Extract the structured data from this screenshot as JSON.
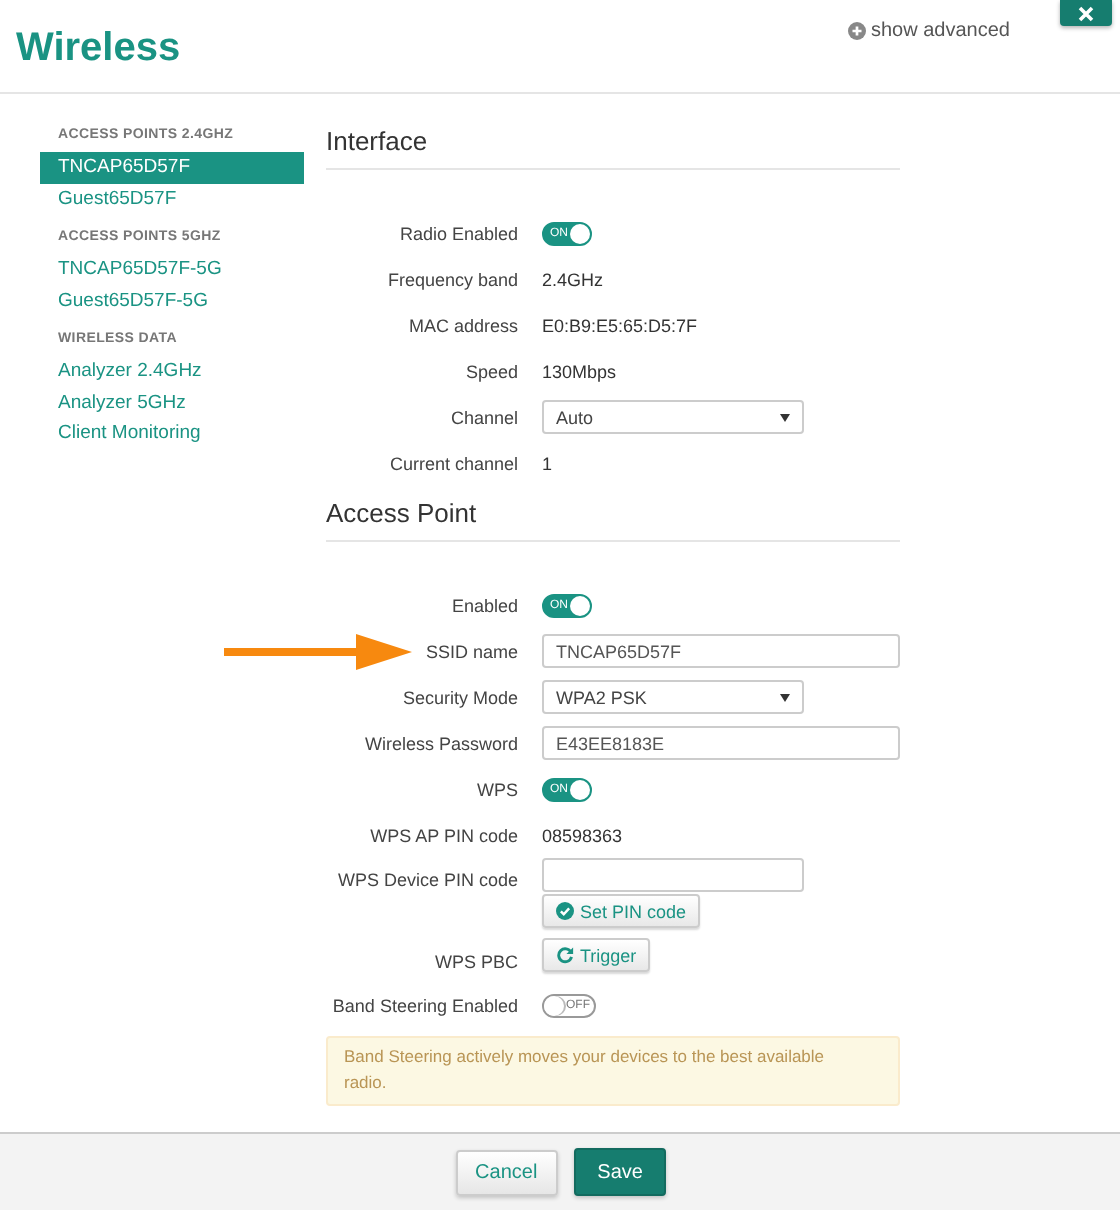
{
  "header": {
    "title": "Wireless",
    "show_advanced": "show advanced"
  },
  "sidebar": {
    "groups": [
      {
        "heading": "ACCESS POINTS 2.4GHZ",
        "items": [
          {
            "label": "TNCAP65D57F",
            "selected": true
          },
          {
            "label": "Guest65D57F",
            "selected": false
          }
        ]
      },
      {
        "heading": "ACCESS POINTS 5GHZ",
        "items": [
          {
            "label": "TNCAP65D57F-5G",
            "selected": false
          },
          {
            "label": "Guest65D57F-5G",
            "selected": false
          }
        ]
      },
      {
        "heading": "WIRELESS DATA",
        "items": [
          {
            "label": "Analyzer 2.4GHz",
            "selected": false
          },
          {
            "label": "Analyzer 5GHz",
            "selected": false
          },
          {
            "label": "Client Monitoring",
            "selected": false
          }
        ]
      }
    ]
  },
  "sections": [
    {
      "title": "Interface",
      "rows": [
        {
          "label": "Radio Enabled",
          "kind": "toggle",
          "on": true,
          "toggle_text": "ON"
        },
        {
          "label": "Frequency band",
          "kind": "text",
          "value": "2.4GHz"
        },
        {
          "label": "MAC address",
          "kind": "text",
          "value": "E0:B9:E5:65:D5:7F"
        },
        {
          "label": "Speed",
          "kind": "text",
          "value": "130Mbps"
        },
        {
          "label": "Channel",
          "kind": "select",
          "value": "Auto"
        },
        {
          "label": "Current channel",
          "kind": "text",
          "value": "1"
        }
      ]
    },
    {
      "title": "Access Point",
      "rows": [
        {
          "label": "Enabled",
          "kind": "toggle",
          "on": true,
          "toggle_text": "ON"
        },
        {
          "label": "SSID name",
          "kind": "input",
          "value": "TNCAP65D57F",
          "annotated": true
        },
        {
          "label": "Security Mode",
          "kind": "select",
          "value": "WPA2 PSK"
        },
        {
          "label": "Wireless Password",
          "kind": "input",
          "value": "E43EE8183E"
        },
        {
          "label": "WPS",
          "kind": "toggle",
          "on": true,
          "toggle_text": "ON"
        },
        {
          "label": "WPS AP PIN code",
          "kind": "text",
          "value": "08598363"
        },
        {
          "label": "WPS Device PIN code",
          "kind": "pin",
          "button": "Set PIN code"
        },
        {
          "label": "WPS PBC",
          "kind": "button",
          "button": "Trigger"
        },
        {
          "label": "Band Steering Enabled",
          "kind": "toggle",
          "on": false,
          "toggle_text": "OFF"
        }
      ],
      "alert": "Band Steering actively moves your devices to the best available radio."
    }
  ],
  "footer": {
    "cancel": "Cancel",
    "save": "Save"
  }
}
